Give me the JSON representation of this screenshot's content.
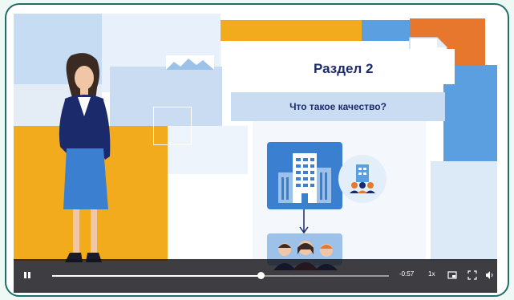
{
  "slide": {
    "section_title": "Раздел 2",
    "question": "Что такое качество?"
  },
  "player": {
    "time_remaining": "-0:57",
    "speed": "1x",
    "progress_fraction": 0.62,
    "state": "playing"
  },
  "icons": [
    "pause-icon",
    "pip-icon",
    "fullscreen-icon",
    "volume-icon",
    "document-icon",
    "building-icon",
    "team-icon"
  ],
  "colors": {
    "frame": "#1f6f66",
    "navy": "#1b2a6b",
    "orange": "#e8772e",
    "yellow": "#f2ab1c",
    "blue": "#5b9fe0"
  }
}
